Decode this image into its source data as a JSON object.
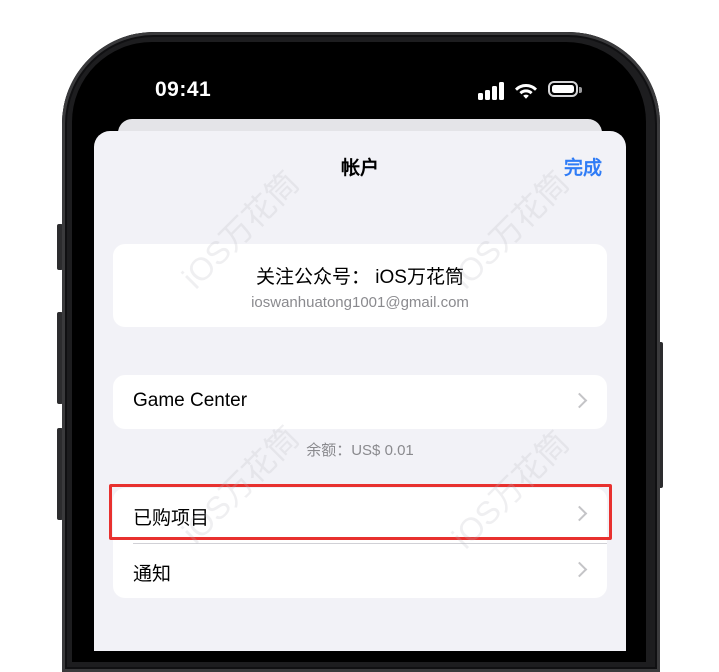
{
  "status_bar": {
    "time": "09:41"
  },
  "sheet": {
    "title": "帐户",
    "done_label": "完成"
  },
  "profile": {
    "name": "关注公众号： iOS万花筒",
    "email": "ioswanhuatong1001@gmail.com"
  },
  "game_center": {
    "label": "Game Center"
  },
  "balance": {
    "text": "余额：US$ 0.01"
  },
  "menu": {
    "items": [
      {
        "label": "已购项目"
      },
      {
        "label": "通知"
      }
    ]
  },
  "watermark": {
    "text": "iOS万花筒"
  },
  "colors": {
    "accent": "#2f7cf6",
    "highlight": "#e8312f",
    "background": "#f2f2f7"
  }
}
